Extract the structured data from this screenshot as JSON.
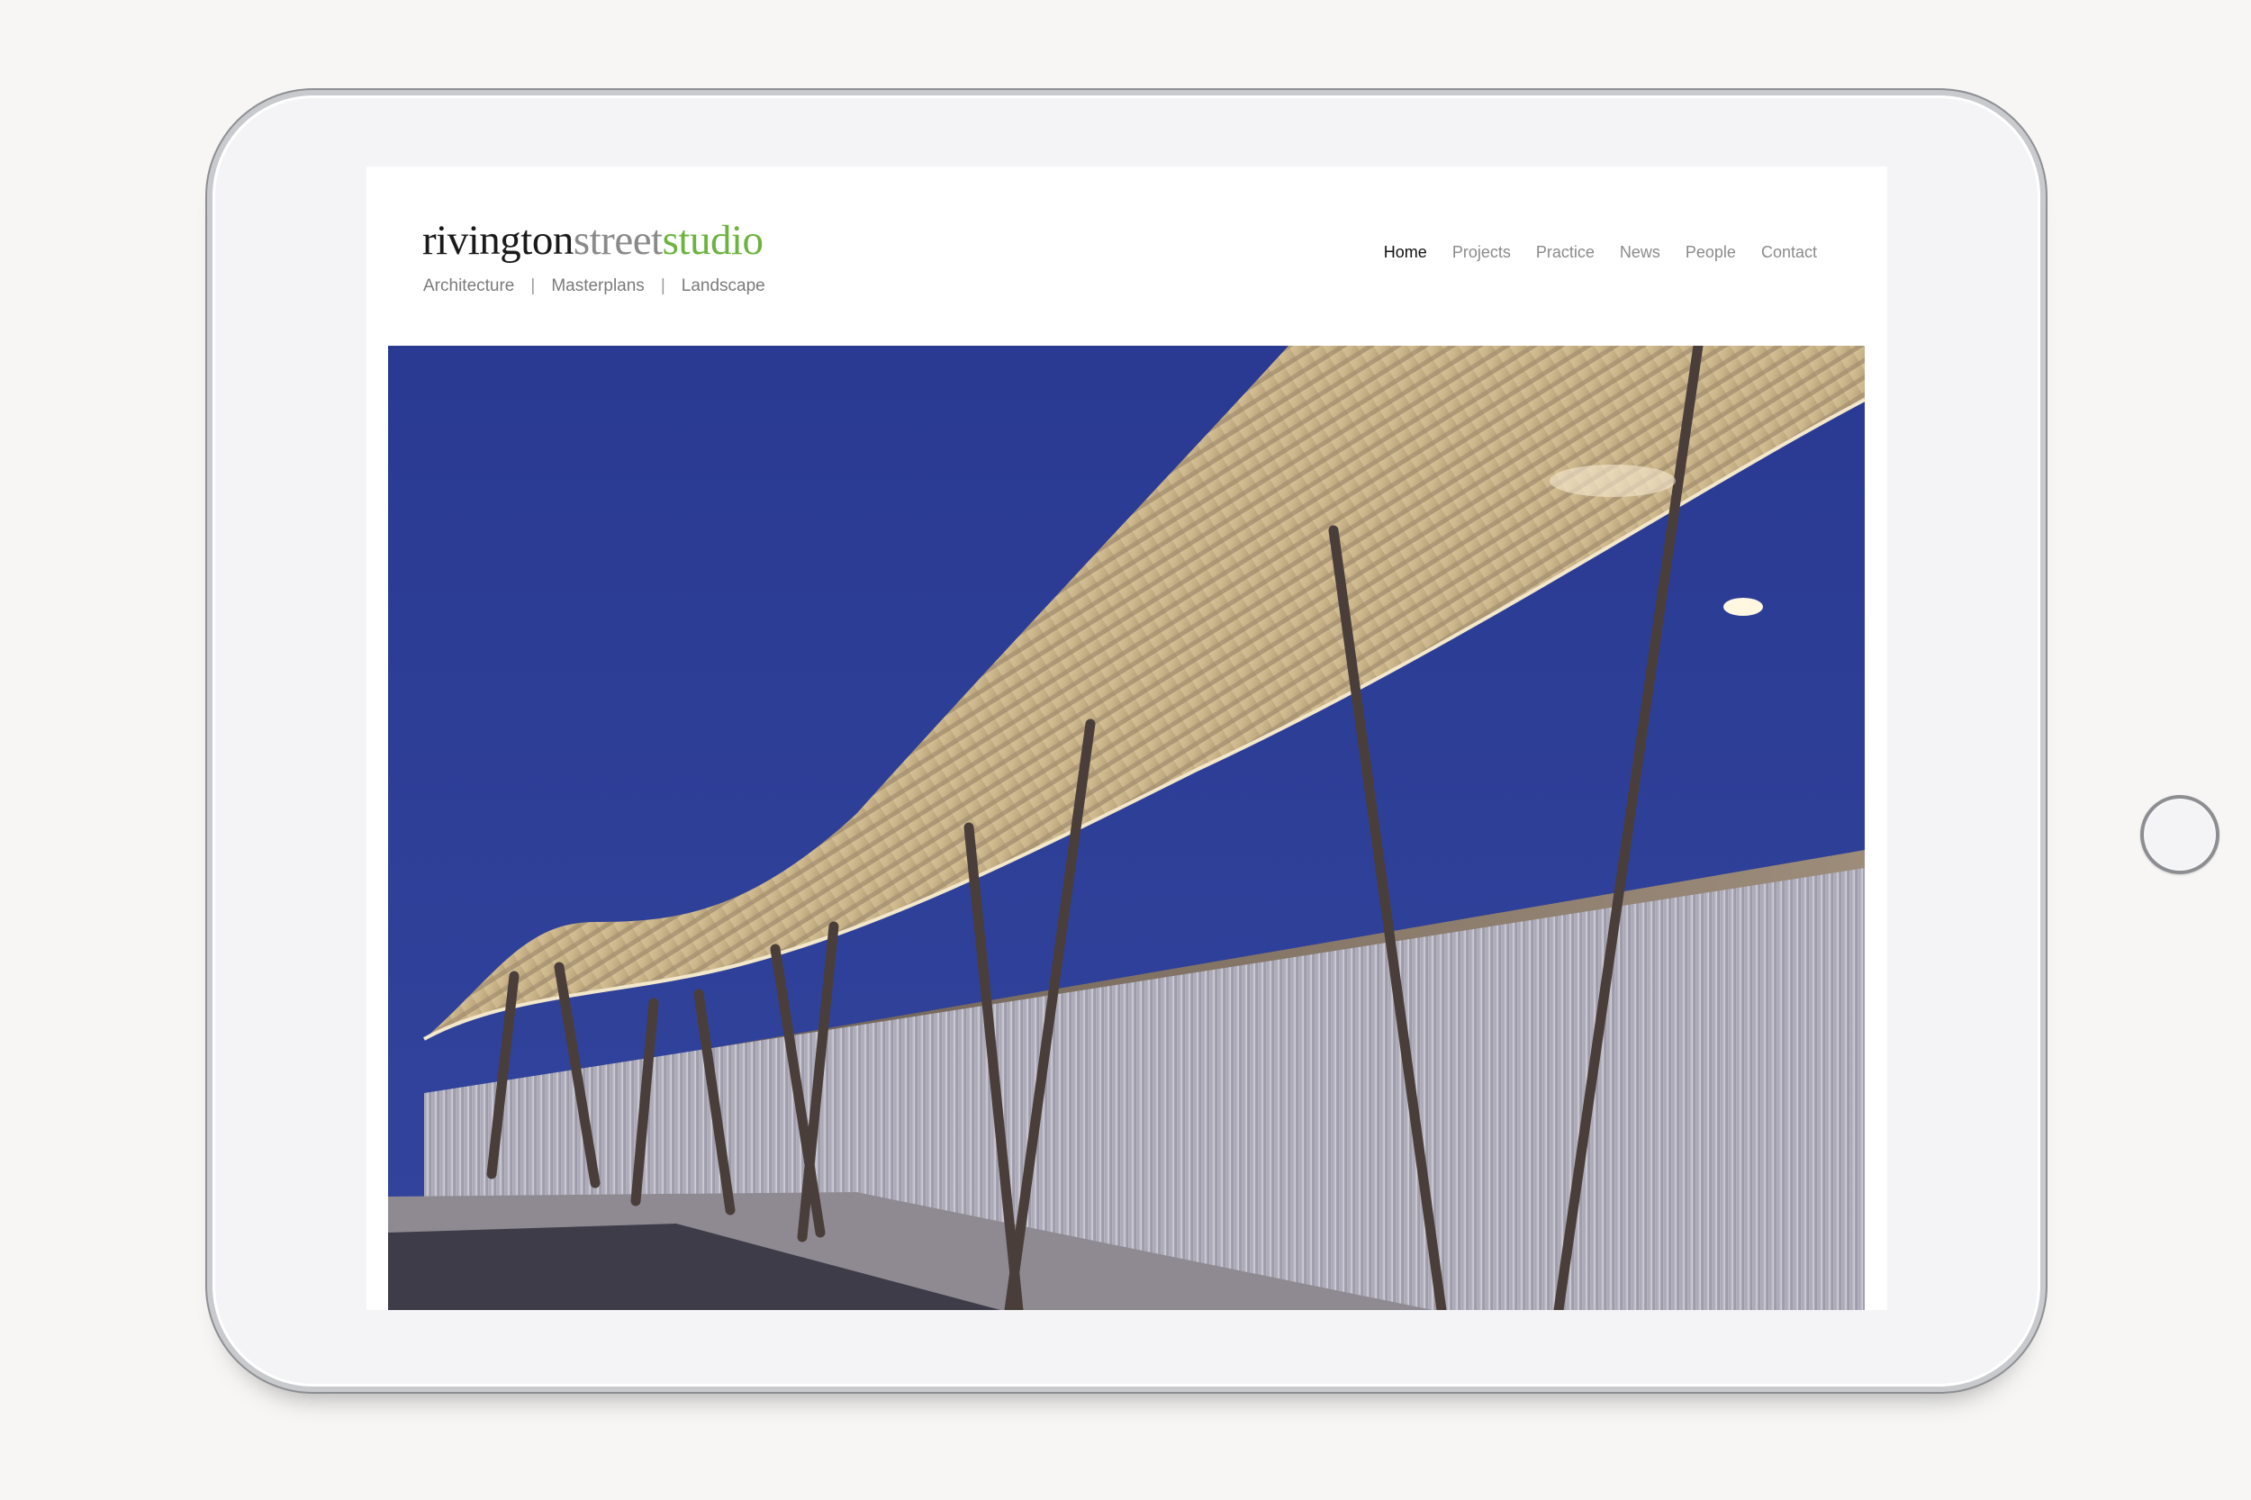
{
  "site": {
    "logo": {
      "word1": "rivington",
      "word2": "street",
      "word3": "studio"
    },
    "tagline": {
      "items": [
        "Architecture",
        "Masterplans",
        "Landscape"
      ],
      "separator": "|"
    },
    "nav": [
      {
        "label": "Home",
        "active": true
      },
      {
        "label": "Projects",
        "active": false
      },
      {
        "label": "Practice",
        "active": false
      },
      {
        "label": "News",
        "active": false
      },
      {
        "label": "People",
        "active": false
      },
      {
        "label": "Contact",
        "active": false
      }
    ]
  },
  "colors": {
    "background": "#f7f6f4",
    "logo_dark": "#1a1a1a",
    "logo_grey": "#8a8a8a",
    "logo_green": "#6db33f",
    "nav_active": "#111111",
    "nav_inactive": "#8b8b8b",
    "sky": "#2b3b95"
  },
  "icons": {
    "camera": "front-camera-icon",
    "home": "home-button-icon"
  }
}
